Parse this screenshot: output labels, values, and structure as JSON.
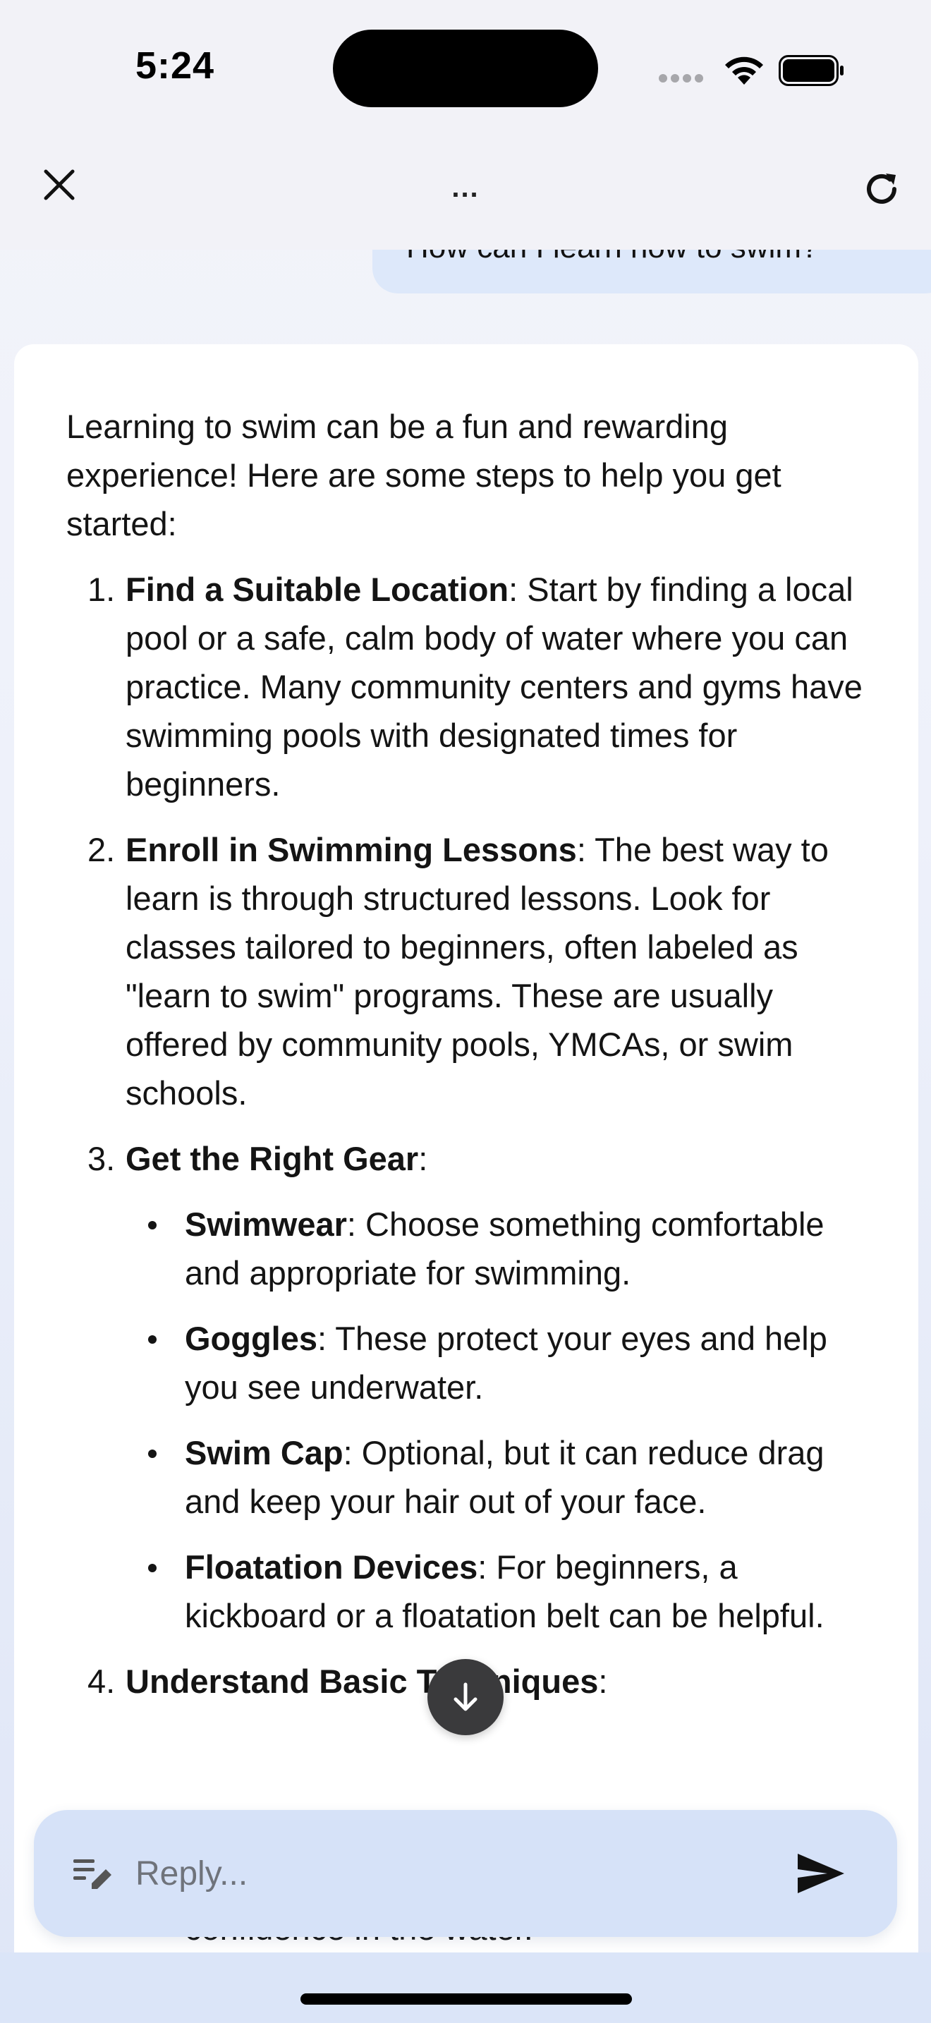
{
  "status_bar": {
    "time": "5:24"
  },
  "header": {
    "title": "..."
  },
  "conversation": {
    "user_message": "How can I learn how to swim?",
    "assistant": {
      "intro": "Learning to swim can be a fun and rewarding experience! Here are some steps to help you get started:",
      "steps": [
        {
          "number": "1.",
          "title": "Find a Suitable Location",
          "text": ": Start by finding a local pool or a safe, calm body of water where you can practice. Many community centers and gyms have swimming pools with designated times for beginners."
        },
        {
          "number": "2.",
          "title": "Enroll in Swimming Lessons",
          "text": ": The best way to learn is through structured lessons. Look for classes tailored to beginners, often labeled as \"learn to swim\" programs. These are usually offered by community pools, YMCAs, or swim schools."
        },
        {
          "number": "3.",
          "title": "Get the Right Gear",
          "text": ":",
          "items": [
            {
              "title": "Swimwear",
              "text": ": Choose something comfortable and appropriate for swimming."
            },
            {
              "title": "Goggles",
              "text": ": These protect your eyes and help you see underwater."
            },
            {
              "title": "Swim Cap",
              "text": ": Optional, but it can reduce drag and keep your hair out of your face."
            },
            {
              "title": "Floatation Devices",
              "text": ": For beginners, a kickboard or a floatation belt can be helpful."
            }
          ]
        },
        {
          "number": "4.",
          "title": "Understand Basic Techniques",
          "text": ":"
        }
      ],
      "partial_line": "confidence in the water."
    }
  },
  "composer": {
    "placeholder": "Reply..."
  },
  "icons": {
    "close": "close-icon",
    "refresh": "refresh-icon",
    "scroll_down": "arrow-down-icon",
    "compose": "compose-icon",
    "send": "send-icon"
  }
}
